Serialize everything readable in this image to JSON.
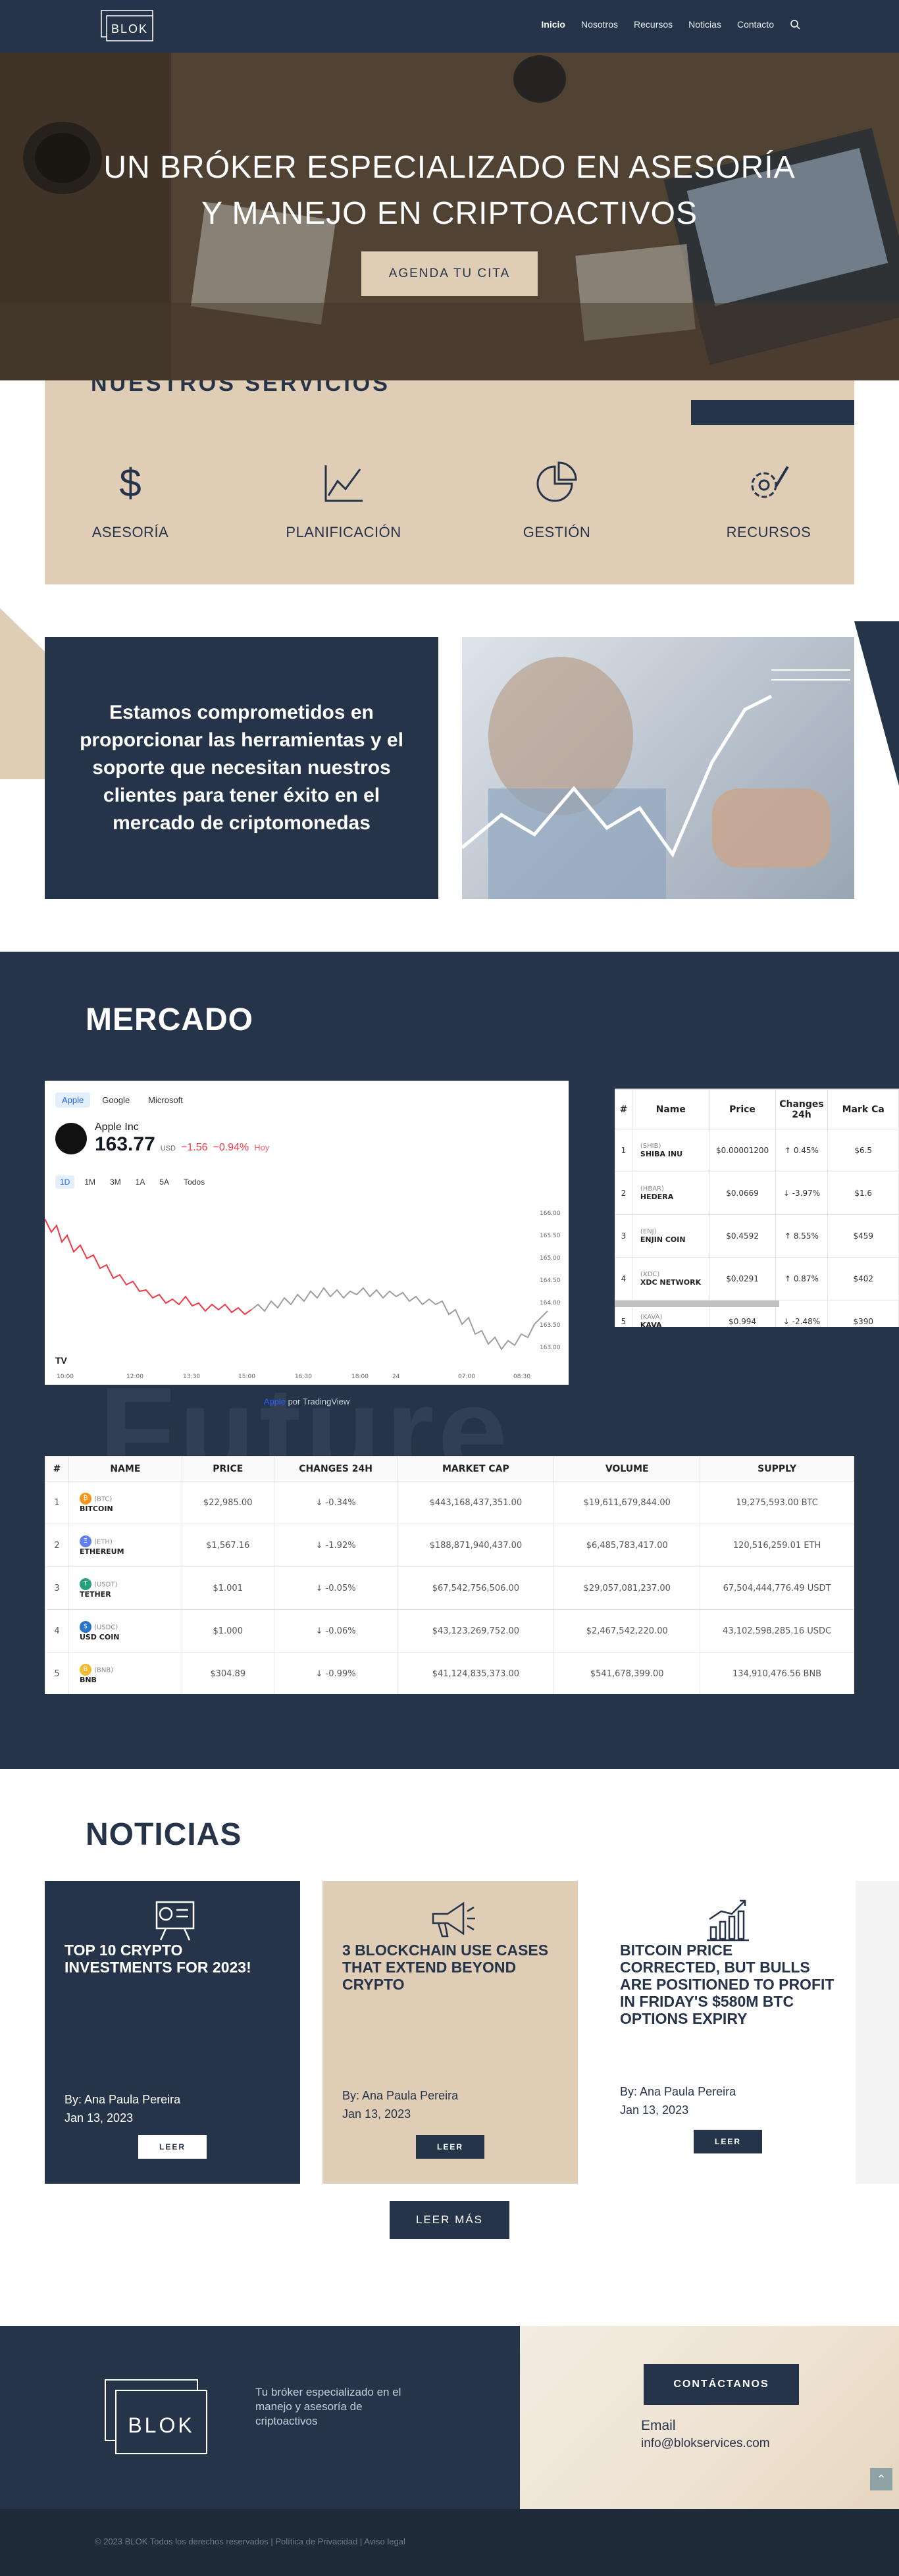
{
  "header": {
    "logo_text": "BLOK",
    "nav": [
      "Inicio",
      "Nosotros",
      "Recursos",
      "Noticias",
      "Contacto"
    ]
  },
  "hero": {
    "title_line1": "UN BRÓKER ESPECIALIZADO EN ASESORÍA",
    "title_line2": "Y MANEJO EN CRIPTOACTIVOS",
    "button": "AGENDA TU CITA"
  },
  "services": {
    "heading": "NUESTROS SERVICIOS",
    "items": [
      {
        "label": "ASESORÍA",
        "icon": "dollar-icon"
      },
      {
        "label": "PLANIFICACIÓN",
        "icon": "line-chart-icon"
      },
      {
        "label": "GESTIÓN",
        "icon": "pie-chart-icon"
      },
      {
        "label": "RECURSOS",
        "icon": "tools-icon"
      }
    ]
  },
  "commitment": {
    "text": "Estamos comprometidos en proporcionar las herramientas y el soporte que necesitan nuestros clientes para tener éxito en el mercado de criptomonedas"
  },
  "market": {
    "title": "MERCADO",
    "watermark": "Future",
    "tv": {
      "tabs": [
        "Apple",
        "Google",
        "Microsoft"
      ],
      "company": "Apple Inc",
      "price": "163.77",
      "currency": "USD",
      "change": "−1.56",
      "change_pct": "−0.94%",
      "change_period": "Hoy",
      "periods": [
        "1D",
        "1M",
        "3M",
        "1A",
        "5A",
        "Todos"
      ],
      "price_scale": [
        "166.00",
        "165.50",
        "165.00",
        "164.50",
        "164.00",
        "163.50",
        "163.00"
      ],
      "time_axis": [
        "10:00",
        "12:00",
        "13:30",
        "15:00",
        "16:30",
        "18:00",
        "24",
        "07:00",
        "08:30"
      ],
      "credit_link": "Apple",
      "credit_rest": " por TradingView"
    },
    "mini_table": {
      "headers": [
        "#",
        "Name",
        "Price",
        "Changes 24h",
        "Mark Ca"
      ],
      "rows": [
        {
          "n": "1",
          "sym": "(SHIB)",
          "name": "SHIBA INU",
          "price": "$0.00001200",
          "chg": "↑ 0.45%",
          "dir": "pos",
          "cap": "$6.5"
        },
        {
          "n": "2",
          "sym": "(HBAR)",
          "name": "HEDERA",
          "price": "$0.0669",
          "chg": "↓ -3.97%",
          "dir": "neg",
          "cap": "$1.6"
        },
        {
          "n": "3",
          "sym": "(ENJ)",
          "name": "ENJIN COIN",
          "price": "$0.4592",
          "chg": "↑ 8.55%",
          "dir": "pos",
          "cap": "$459"
        },
        {
          "n": "4",
          "sym": "(XDC)",
          "name": "XDC NETWORK",
          "price": "$0.0291",
          "chg": "↑ 0.87%",
          "dir": "pos",
          "cap": "$402"
        },
        {
          "n": "5",
          "sym": "(KAVA)",
          "name": "KAVA",
          "price": "$0.994",
          "chg": "↓ -2.48%",
          "dir": "neg",
          "cap": "$390"
        }
      ]
    },
    "crypto_table": {
      "headers": [
        "#",
        "NAME",
        "PRICE",
        "CHANGES 24H",
        "MARKET CAP",
        "VOLUME",
        "SUPPLY"
      ],
      "rows": [
        {
          "n": "1",
          "sym": "(BTC)",
          "name": "BITCOIN",
          "color": "#f7931a",
          "glyph": "₿",
          "price": "$22,985.00",
          "chg": "↓ -0.34%",
          "cap": "$443,168,437,351.00",
          "vol": "$19,611,679,844.00",
          "supply": "19,275,593.00 BTC"
        },
        {
          "n": "2",
          "sym": "(ETH)",
          "name": "ETHEREUM",
          "color": "#627eea",
          "glyph": "Ξ",
          "price": "$1,567.16",
          "chg": "↓ -1.92%",
          "cap": "$188,871,940,437.00",
          "vol": "$6,485,783,417.00",
          "supply": "120,516,259.01 ETH"
        },
        {
          "n": "3",
          "sym": "(USDT)",
          "name": "TETHER",
          "color": "#26a17b",
          "glyph": "T",
          "price": "$1.001",
          "chg": "↓ -0.05%",
          "cap": "$67,542,756,506.00",
          "vol": "$29,057,081,237.00",
          "supply": "67,504,444,776.49 USDT"
        },
        {
          "n": "4",
          "sym": "(USDC)",
          "name": "USD COIN",
          "color": "#2775ca",
          "glyph": "$",
          "price": "$1.000",
          "chg": "↓ -0.06%",
          "cap": "$43,123,269,752.00",
          "vol": "$2,467,542,220.00",
          "supply": "43,102,598,285.16 USDC"
        },
        {
          "n": "5",
          "sym": "(BNB)",
          "name": "BNB",
          "color": "#f3ba2f",
          "glyph": "B",
          "price": "$304.89",
          "chg": "↓ -0.99%",
          "cap": "$41,124,835,373.00",
          "vol": "$541,678,399.00",
          "supply": "134,910,476.56 BNB"
        }
      ]
    }
  },
  "news": {
    "title": "NOTICIAS",
    "cards": [
      {
        "title": "TOP 10 CRYPTO INVESTMENTS FOR 2023!",
        "author": "By: Ana Paula Pereira",
        "date": "Jan 13, 2023",
        "button": "LEER",
        "icon": "presentation-icon"
      },
      {
        "title": "3 BLOCKCHAIN USE CASES THAT EXTEND BEYOND CRYPTO",
        "author": "By: Ana Paula Pereira",
        "date": "Jan 13, 2023",
        "button": "LEER",
        "icon": "megaphone-icon"
      },
      {
        "title": "BITCOIN PRICE CORRECTED, BUT BULLS ARE POSITIONED TO PROFIT IN FRIDAY'S $580M BTC OPTIONS EXPIRY",
        "author": "By: Ana Paula Pereira",
        "date": "Jan 13, 2023",
        "button": "LEER",
        "icon": "bar-growth-icon"
      }
    ],
    "more_button": "LEER MÁS"
  },
  "footer": {
    "logo_text": "BLOK",
    "tagline": "Tu bróker especializado en el manejo y asesoría de criptoactivos",
    "contact_button": "CONTÁCTANOS",
    "email_label": "Email",
    "email": "info@blokservices.com",
    "copyright": "© 2023 BLOK Todos los derechos reservados | Política de Privacidad | Aviso legal"
  },
  "colors": {
    "navy": "#26344a",
    "beige": "#e0cdb6",
    "negative": "#e53935",
    "positive": "#43a047"
  }
}
